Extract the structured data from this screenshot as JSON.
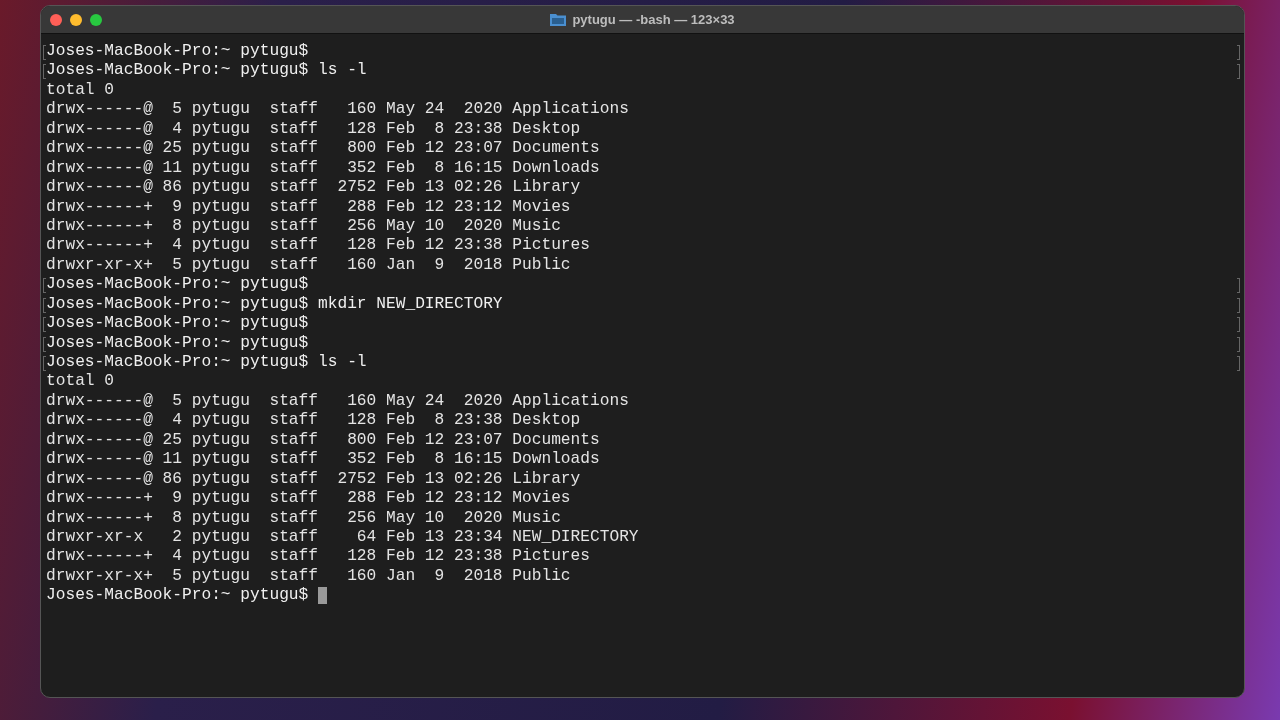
{
  "window": {
    "title": "pytugu — -bash — 123×33"
  },
  "terminal": {
    "lines": [
      {
        "kind": "prompt",
        "text": "Joses-MacBook-Pro:~ pytugu$",
        "marked": true
      },
      {
        "kind": "prompt",
        "text": "Joses-MacBook-Pro:~ pytugu$ ls -l",
        "marked": true
      },
      {
        "kind": "output",
        "text": "total 0"
      },
      {
        "kind": "output",
        "text": "drwx------@  5 pytugu  staff   160 May 24  2020 Applications"
      },
      {
        "kind": "output",
        "text": "drwx------@  4 pytugu  staff   128 Feb  8 23:38 Desktop"
      },
      {
        "kind": "output",
        "text": "drwx------@ 25 pytugu  staff   800 Feb 12 23:07 Documents"
      },
      {
        "kind": "output",
        "text": "drwx------@ 11 pytugu  staff   352 Feb  8 16:15 Downloads"
      },
      {
        "kind": "output",
        "text": "drwx------@ 86 pytugu  staff  2752 Feb 13 02:26 Library"
      },
      {
        "kind": "output",
        "text": "drwx------+  9 pytugu  staff   288 Feb 12 23:12 Movies"
      },
      {
        "kind": "output",
        "text": "drwx------+  8 pytugu  staff   256 May 10  2020 Music"
      },
      {
        "kind": "output",
        "text": "drwx------+  4 pytugu  staff   128 Feb 12 23:38 Pictures"
      },
      {
        "kind": "output",
        "text": "drwxr-xr-x+  5 pytugu  staff   160 Jan  9  2018 Public"
      },
      {
        "kind": "prompt",
        "text": "Joses-MacBook-Pro:~ pytugu$",
        "marked": true
      },
      {
        "kind": "prompt",
        "text": "Joses-MacBook-Pro:~ pytugu$ mkdir NEW_DIRECTORY",
        "marked": true
      },
      {
        "kind": "prompt",
        "text": "Joses-MacBook-Pro:~ pytugu$",
        "marked": true
      },
      {
        "kind": "prompt",
        "text": "Joses-MacBook-Pro:~ pytugu$",
        "marked": true
      },
      {
        "kind": "prompt",
        "text": "Joses-MacBook-Pro:~ pytugu$ ls -l",
        "marked": true
      },
      {
        "kind": "output",
        "text": "total 0"
      },
      {
        "kind": "output",
        "text": "drwx------@  5 pytugu  staff   160 May 24  2020 Applications"
      },
      {
        "kind": "output",
        "text": "drwx------@  4 pytugu  staff   128 Feb  8 23:38 Desktop"
      },
      {
        "kind": "output",
        "text": "drwx------@ 25 pytugu  staff   800 Feb 12 23:07 Documents"
      },
      {
        "kind": "output",
        "text": "drwx------@ 11 pytugu  staff   352 Feb  8 16:15 Downloads"
      },
      {
        "kind": "output",
        "text": "drwx------@ 86 pytugu  staff  2752 Feb 13 02:26 Library"
      },
      {
        "kind": "output",
        "text": "drwx------+  9 pytugu  staff   288 Feb 12 23:12 Movies"
      },
      {
        "kind": "output",
        "text": "drwx------+  8 pytugu  staff   256 May 10  2020 Music"
      },
      {
        "kind": "output",
        "text": "drwxr-xr-x   2 pytugu  staff    64 Feb 13 23:34 NEW_DIRECTORY"
      },
      {
        "kind": "output",
        "text": "drwx------+  4 pytugu  staff   128 Feb 12 23:38 Pictures"
      },
      {
        "kind": "output",
        "text": "drwxr-xr-x+  5 pytugu  staff   160 Jan  9  2018 Public"
      },
      {
        "kind": "prompt",
        "text": "Joses-MacBook-Pro:~ pytugu$",
        "marked": false,
        "cursor": true
      }
    ]
  }
}
